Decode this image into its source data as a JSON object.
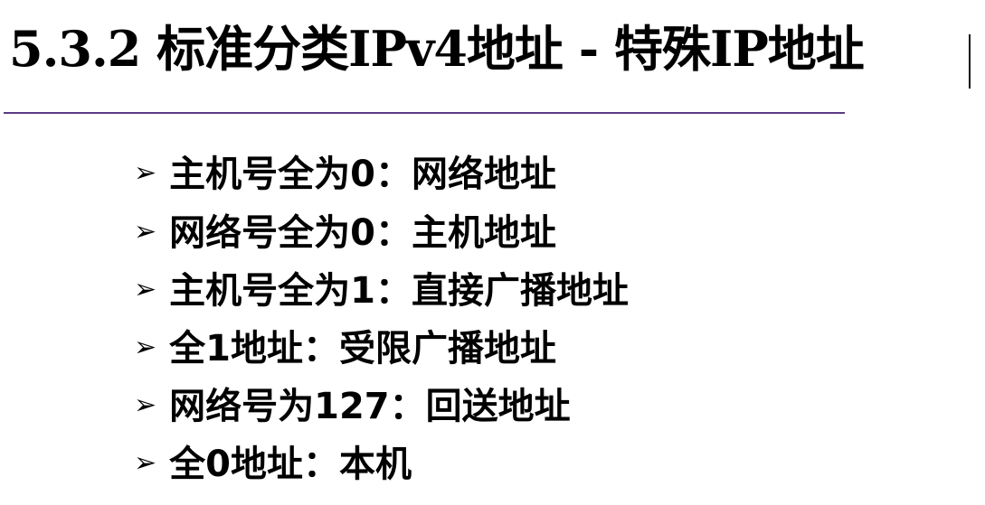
{
  "slide": {
    "title": "5.3.2 标准分类IPv4地址 - 特殊IP地址",
    "bullet_marker": "➢",
    "bullets": [
      "主机号全为0：网络地址",
      "网络号全为0：主机地址",
      "主机号全为1：直接广播地址",
      "全1地址：受限广播地址",
      "网络号为127：回送地址",
      "全0地址：本机"
    ]
  },
  "colors": {
    "rule": "#5c3b86",
    "text": "#000000",
    "background": "#ffffff"
  }
}
